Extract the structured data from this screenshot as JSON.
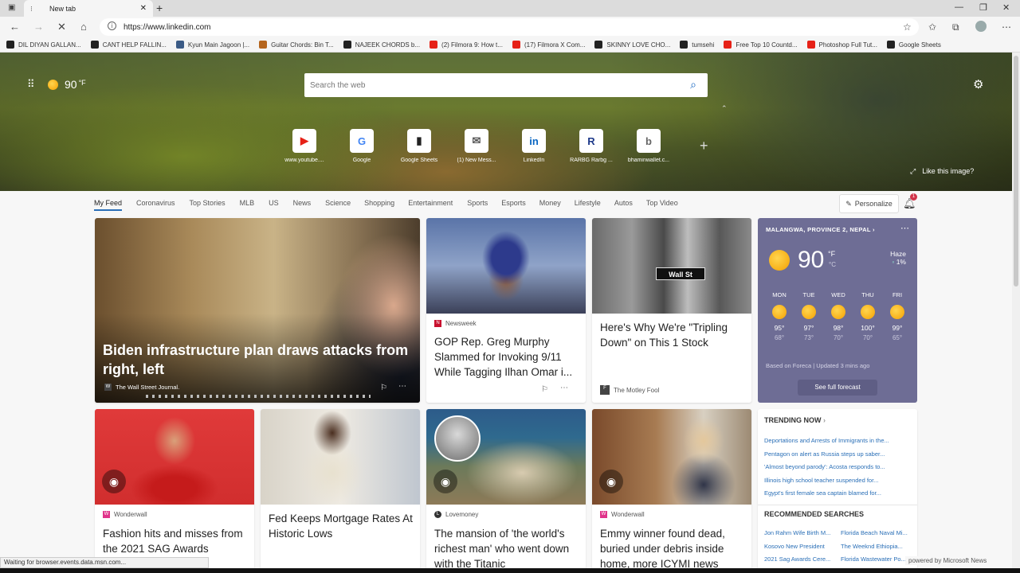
{
  "browser": {
    "tab_title": "New tab",
    "url": "https://www.linkedin.com",
    "bookmarks": [
      {
        "label": "DIL DIYAN GALLAN...",
        "color": "#222"
      },
      {
        "label": "CANT HELP FALLIN...",
        "color": "#222"
      },
      {
        "label": "Kyun Main Jagoon |...",
        "color": "#3b5b86"
      },
      {
        "label": "Guitar Chords: Bin T...",
        "color": "#b5651d"
      },
      {
        "label": "NAJEEK CHORDS b...",
        "color": "#222"
      },
      {
        "label": "(2) Filmora 9: How t...",
        "color": "#e62117"
      },
      {
        "label": "(17) Filmora X Com...",
        "color": "#e62117"
      },
      {
        "label": "SKINNY LOVE CHO...",
        "color": "#222"
      },
      {
        "label": "tumsehi",
        "color": "#222"
      },
      {
        "label": "Free Top 10 Countd...",
        "color": "#e62117"
      },
      {
        "label": "Photoshop Full Tut...",
        "color": "#e62117"
      },
      {
        "label": "Google Sheets",
        "color": "#222"
      }
    ]
  },
  "hero": {
    "temperature": "90",
    "unit": "°F",
    "search_placeholder": "Search the web",
    "like_image": "Like this image?",
    "quick_links": [
      {
        "label": "www.youtube....",
        "glyph": "▶",
        "color": "#e62117"
      },
      {
        "label": "Google",
        "glyph": "G",
        "color": "#4285f4"
      },
      {
        "label": "Google Sheets",
        "glyph": "▮",
        "color": "#222"
      },
      {
        "label": "(1) New Mess...",
        "glyph": "✉",
        "color": "#555"
      },
      {
        "label": "LinkedIn",
        "glyph": "in",
        "color": "#0a66c2"
      },
      {
        "label": "RARBG Rarbg ...",
        "glyph": "R",
        "color": "#1e3a8a"
      },
      {
        "label": "bhaminwallet.c...",
        "glyph": "b",
        "color": "#666"
      }
    ]
  },
  "feed_nav": {
    "tabs": [
      "My Feed",
      "Coronavirus",
      "Top Stories",
      "MLB",
      "US",
      "News",
      "Science",
      "Shopping",
      "Entertainment",
      "Sports",
      "Esports",
      "Money",
      "Lifestyle",
      "Autos",
      "Top Video"
    ],
    "personalize": "Personalize",
    "notification_count": "1"
  },
  "cards": {
    "main": {
      "headline": "Biden infrastructure plan draws attacks from right, left",
      "source": "The Wall Street Journal."
    },
    "omar": {
      "source": "Newsweek",
      "headline": "GOP Rep. Greg Murphy Slammed for Invoking 9/11 While Tagging Ilhan Omar i..."
    },
    "wall": {
      "headline": "Here's Why We're \"Tripling Down\" on This 1 Stock",
      "source": "The Motley Fool",
      "sign": "Wall St"
    },
    "sag": {
      "source": "Wonderwall",
      "headline": "Fashion hits and misses from the 2021 SAG Awards"
    },
    "fed": {
      "headline": "Fed Keeps Mortgage Rates At Historic Lows"
    },
    "titanic": {
      "source": "Lovemoney",
      "headline": "The mansion of 'the world's richest man' who went down with the Titanic"
    },
    "emmy": {
      "source": "Wonderwall",
      "headline": "Emmy winner found dead, buried under debris inside home, more ICYMI news"
    }
  },
  "weather": {
    "location": "MALANGWA, PROVINCE 2, NEPAL",
    "temp": "90",
    "unit_f": "°F",
    "unit_c": "°C",
    "condition": "Haze",
    "precip": "1%",
    "days": [
      {
        "day": "MON",
        "hi": "95°",
        "lo": "68°"
      },
      {
        "day": "TUE",
        "hi": "97°",
        "lo": "73°"
      },
      {
        "day": "WED",
        "hi": "98°",
        "lo": "70°"
      },
      {
        "day": "THU",
        "hi": "100°",
        "lo": "70°"
      },
      {
        "day": "FRI",
        "hi": "99°",
        "lo": "65°"
      }
    ],
    "based_on": "Based on Foreca | Updated 3 mins ago",
    "full_forecast": "See full forecast"
  },
  "trending": {
    "title": "TRENDING NOW",
    "items": [
      "Deportations and Arrests of Immigrants in the...",
      "Pentagon on alert as Russia steps up saber...",
      "'Almost beyond parody': Acosta responds to...",
      "Illinois high school teacher suspended for...",
      "Egypt's first female sea captain blamed for..."
    ],
    "recommended_title": "RECOMMENDED SEARCHES",
    "recommended": [
      "Jon Rahm Wife Birth M...",
      "Florida Beach Naval Mi...",
      "Kosovo New President",
      "The Weeknd Ethiopia...",
      "2021 Sag Awards Cere...",
      "Florida Wastewater Po..."
    ]
  },
  "status": "Waiting for browser.events.data.msn.com...",
  "powered": "powered by Microsoft News"
}
